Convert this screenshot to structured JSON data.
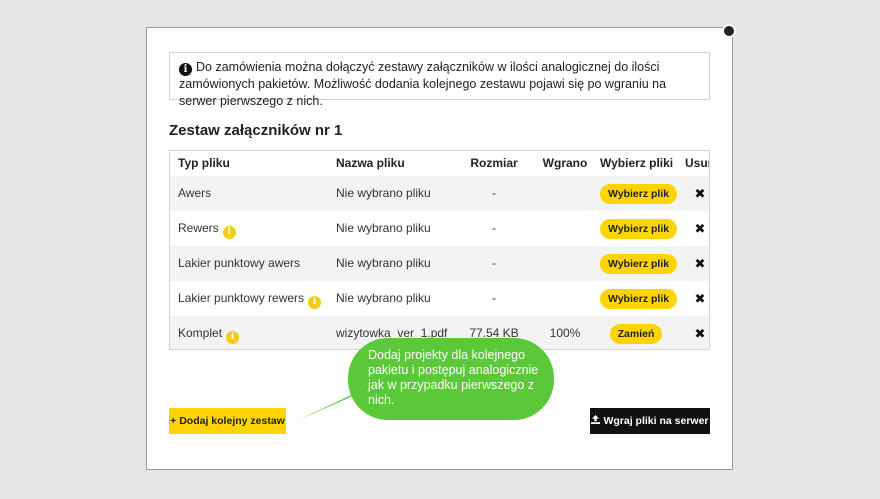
{
  "info": {
    "icon": "info-icon",
    "text": "Do zamówienia można dołączyć zestawy załączników w ilości analogicznej do ilości zamówionych pakietów. Możliwość dodania kolejnego zestawu pojawi się po wgraniu na serwer pierwszego z nich."
  },
  "set_title": "Zestaw załączników nr 1",
  "table": {
    "headers": {
      "type": "Typ pliku",
      "name": "Nazwa pliku",
      "size": "Rozmiar",
      "uploaded": "Wgrano",
      "pick": "Wybierz pliki",
      "delete": "Usuń"
    },
    "rows": [
      {
        "type": "Awers",
        "info": false,
        "name": "Nie wybrano pliku",
        "size": "-",
        "uploaded": "",
        "button": "Wybierz plik"
      },
      {
        "type": "Rewers",
        "info": true,
        "name": "Nie wybrano pliku",
        "size": "-",
        "uploaded": "",
        "button": "Wybierz plik"
      },
      {
        "type": "Lakier punktowy awers",
        "info": false,
        "name": "Nie wybrano pliku",
        "size": "-",
        "uploaded": "",
        "button": "Wybierz plik"
      },
      {
        "type": "Lakier punktowy rewers",
        "info": true,
        "name": "Nie wybrano pliku",
        "size": "-",
        "uploaded": "",
        "button": "Wybierz plik"
      },
      {
        "type": "Komplet",
        "info": true,
        "name": "wizytowka_ver_1.pdf",
        "size": "77.54 KB",
        "uploaded": "100%",
        "button": "Zamień"
      }
    ],
    "delete_glyph": "✖"
  },
  "buttons": {
    "add_set": "Dodaj kolejny zestaw",
    "add_icon": "+",
    "upload": "Wgraj pliki na serwer",
    "upload_icon": "upload-icon"
  },
  "tooltip": {
    "text": "Dodaj projekty dla kolejnego pakietu i postępuj analogicznie jak w przypadku pierwszego z nich.",
    "color": "#5bc83a"
  },
  "colors": {
    "accent_yellow": "#ffd400",
    "dark": "#111111",
    "bubble_green": "#5bc83a"
  }
}
